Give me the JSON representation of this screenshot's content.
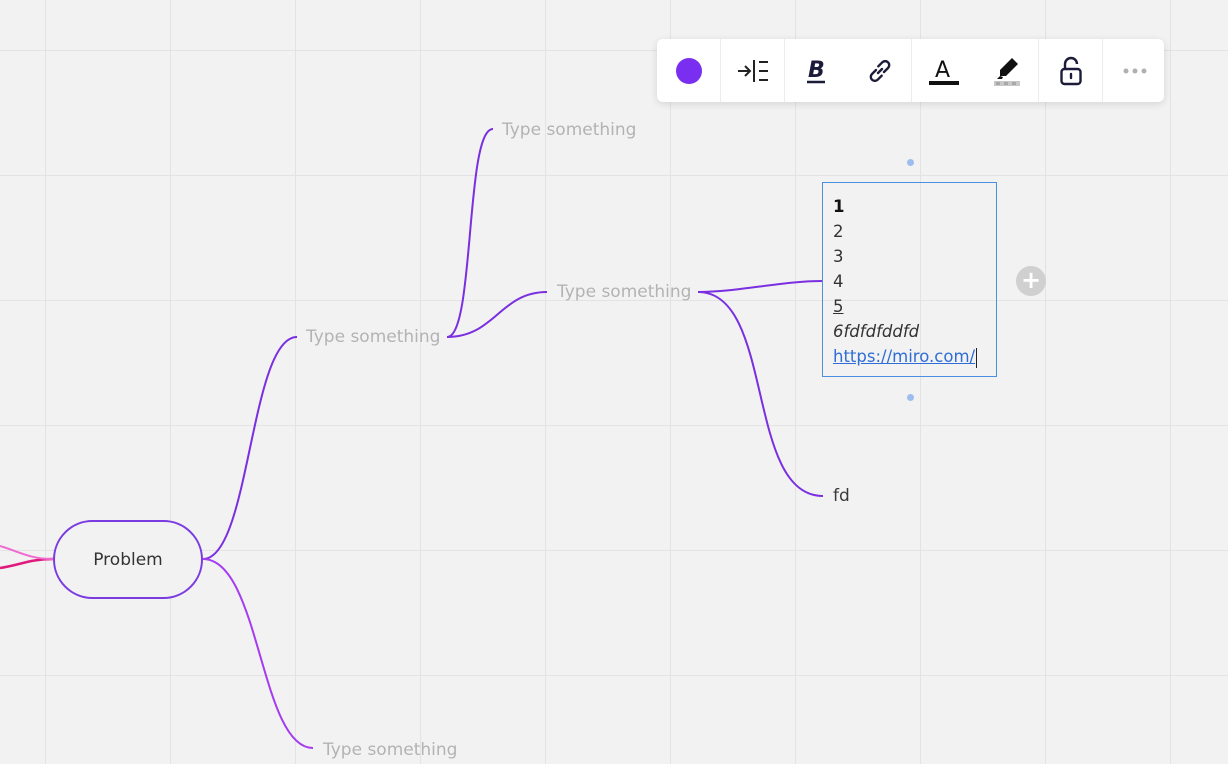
{
  "canvas": {
    "background": "#f2f2f2",
    "grid_color": "#e3e3e3"
  },
  "mindmap": {
    "root": {
      "label": "Problem"
    },
    "nodes": {
      "branch_top_left": "Type something",
      "branch_bottom": "Type something",
      "branch_top_child": "Type something",
      "branch_mid": "Type something",
      "leaf_fd": "fd"
    },
    "selected_node": {
      "lines": [
        "1",
        "2",
        "3",
        "4",
        "5",
        "6fdfdfddfd",
        "https://miro.com/"
      ]
    },
    "connector_colors": {
      "purple": "#7a2fe0",
      "violet": "#a63cf0",
      "pink": "#e0197c",
      "light_pink": "#f06ad0"
    }
  },
  "toolbar": {
    "color_swatch": "#7a2ff0",
    "buttons": [
      {
        "icon": "color-circle-icon"
      },
      {
        "icon": "indent-icon"
      },
      {
        "icon": "bold-icon"
      },
      {
        "icon": "link-icon"
      },
      {
        "icon": "text-color-icon"
      },
      {
        "icon": "highlight-icon"
      },
      {
        "icon": "unlock-icon"
      },
      {
        "icon": "more-icon"
      }
    ]
  },
  "add_button": {
    "icon": "plus-icon",
    "label": "+"
  }
}
